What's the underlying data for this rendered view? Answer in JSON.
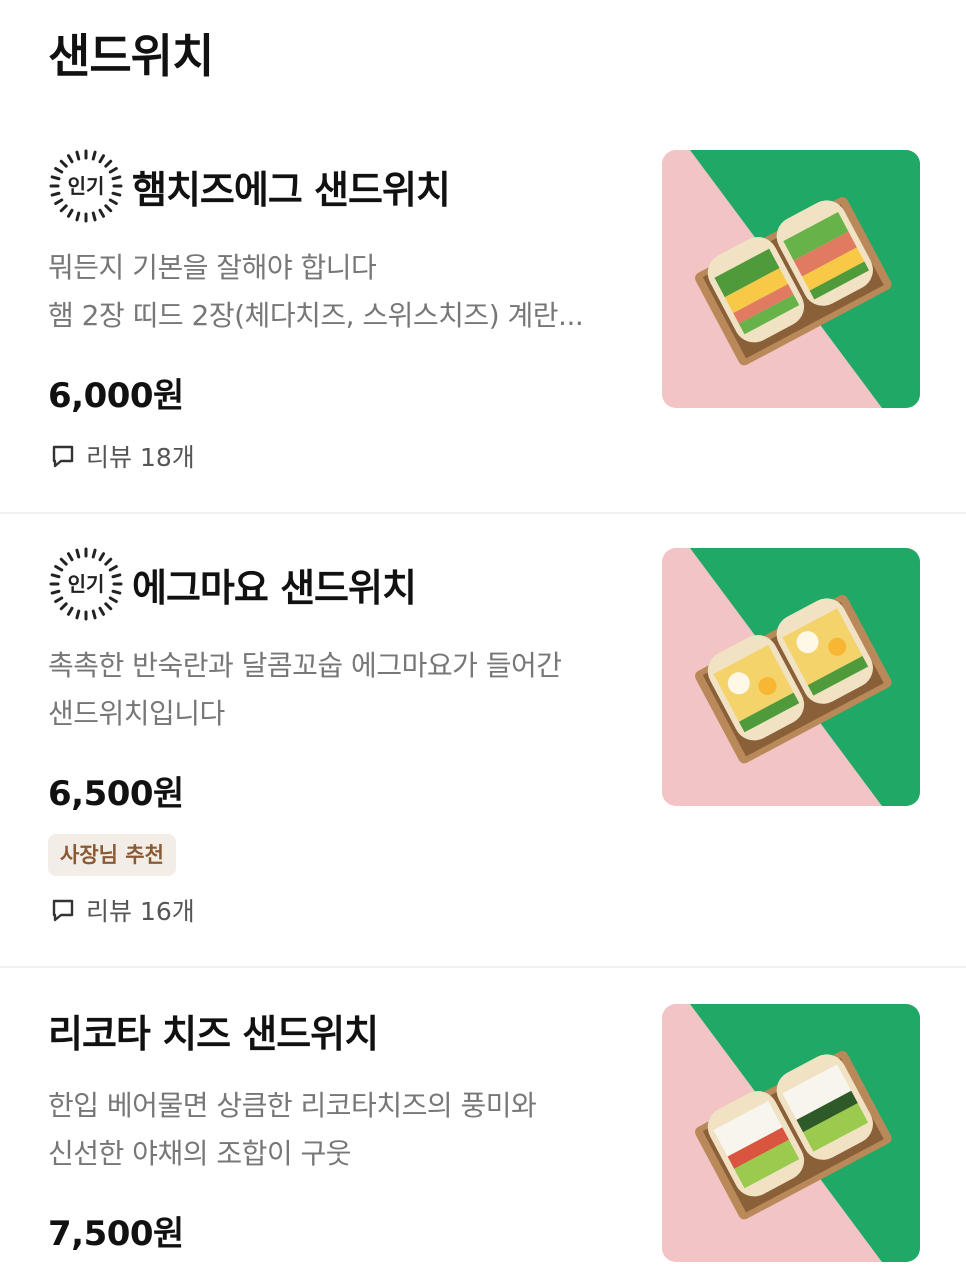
{
  "section": {
    "title": "샌드위치"
  },
  "badges": {
    "popular_label": "인기"
  },
  "items": [
    {
      "name": "햄치즈에그 샌드위치",
      "popular": true,
      "description_lines": [
        "뭐든지 기본을 잘해야 합니다",
        "햄 2장 띠드 2장(체다치즈, 스위스치즈) 계란..."
      ],
      "price": "6,000원",
      "review": "리뷰 18개",
      "image_icon": "sandwich-photo"
    },
    {
      "name": "에그마요 샌드위치",
      "popular": true,
      "description_lines": [
        "촉촉한 반숙란과 달콤꼬숩 에그마요가 들어간",
        "샌드위치입니다"
      ],
      "price": "6,500원",
      "owner_badge": "사장님 추천",
      "review": "리뷰 16개",
      "image_icon": "sandwich-photo"
    },
    {
      "name": "리코타 치즈 샌드위치",
      "popular": false,
      "description_lines": [
        "한입 베어물면 상큼한 리코타치즈의 풍미와",
        "신선한 야채의 조합이 구웃"
      ],
      "price": "7,500원",
      "image_icon": "sandwich-photo"
    }
  ],
  "colors": {
    "photo_green": "#1fa866",
    "photo_pink": "#f2c4c6",
    "owner_badge_bg": "#f2ede7",
    "owner_badge_text": "#8a5a36",
    "description_text": "#777777"
  }
}
